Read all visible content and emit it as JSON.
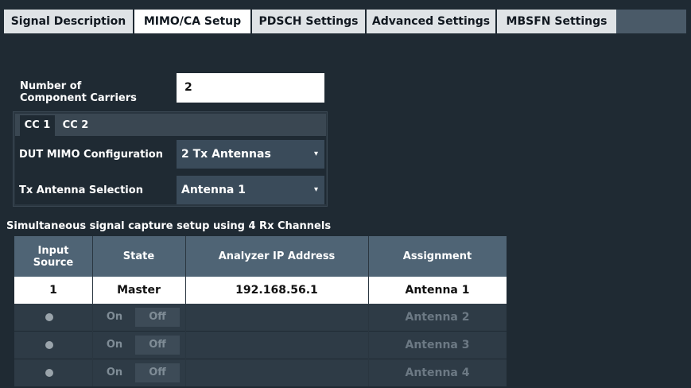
{
  "tabs": [
    {
      "label": "Signal Description"
    },
    {
      "label": "MIMO/CA Setup"
    },
    {
      "label": "PDSCH Settings"
    },
    {
      "label": "Advanced Settings"
    },
    {
      "label": "MBSFN Settings"
    }
  ],
  "active_tab": "MIMO/CA Setup",
  "component_carriers": {
    "label_line1": "Number of",
    "label_line2": "Component Carriers",
    "value": "2"
  },
  "cc_tabs": [
    {
      "label": "CC 1"
    },
    {
      "label": "CC 2"
    }
  ],
  "active_cc": "CC 1",
  "dut_mimo": {
    "label": "DUT MIMO Configuration",
    "value": "2 Tx Antennas"
  },
  "tx_antenna": {
    "label": "Tx Antenna Selection",
    "value": "Antenna 1"
  },
  "capture_title": "Simultaneous signal capture setup using 4 Rx Channels",
  "table": {
    "headers": {
      "input_line1": "Input",
      "input_line2": "Source",
      "state": "State",
      "ip": "Analyzer IP Address",
      "assignment": "Assignment"
    },
    "master_row": {
      "input": "1",
      "state": "Master",
      "ip": "192.168.56.1",
      "assignment": "Antenna 1"
    },
    "rows": [
      {
        "on": "On",
        "off": "Off",
        "ip": "",
        "assignment": "Antenna 2"
      },
      {
        "on": "On",
        "off": "Off",
        "ip": "",
        "assignment": "Antenna 3"
      },
      {
        "on": "On",
        "off": "Off",
        "ip": "",
        "assignment": "Antenna 4"
      }
    ]
  },
  "colors": {
    "background": "#1f2a33",
    "header": "#4f6475",
    "dropdown": "#3a4b5a",
    "tab": "#dfe3e6"
  }
}
